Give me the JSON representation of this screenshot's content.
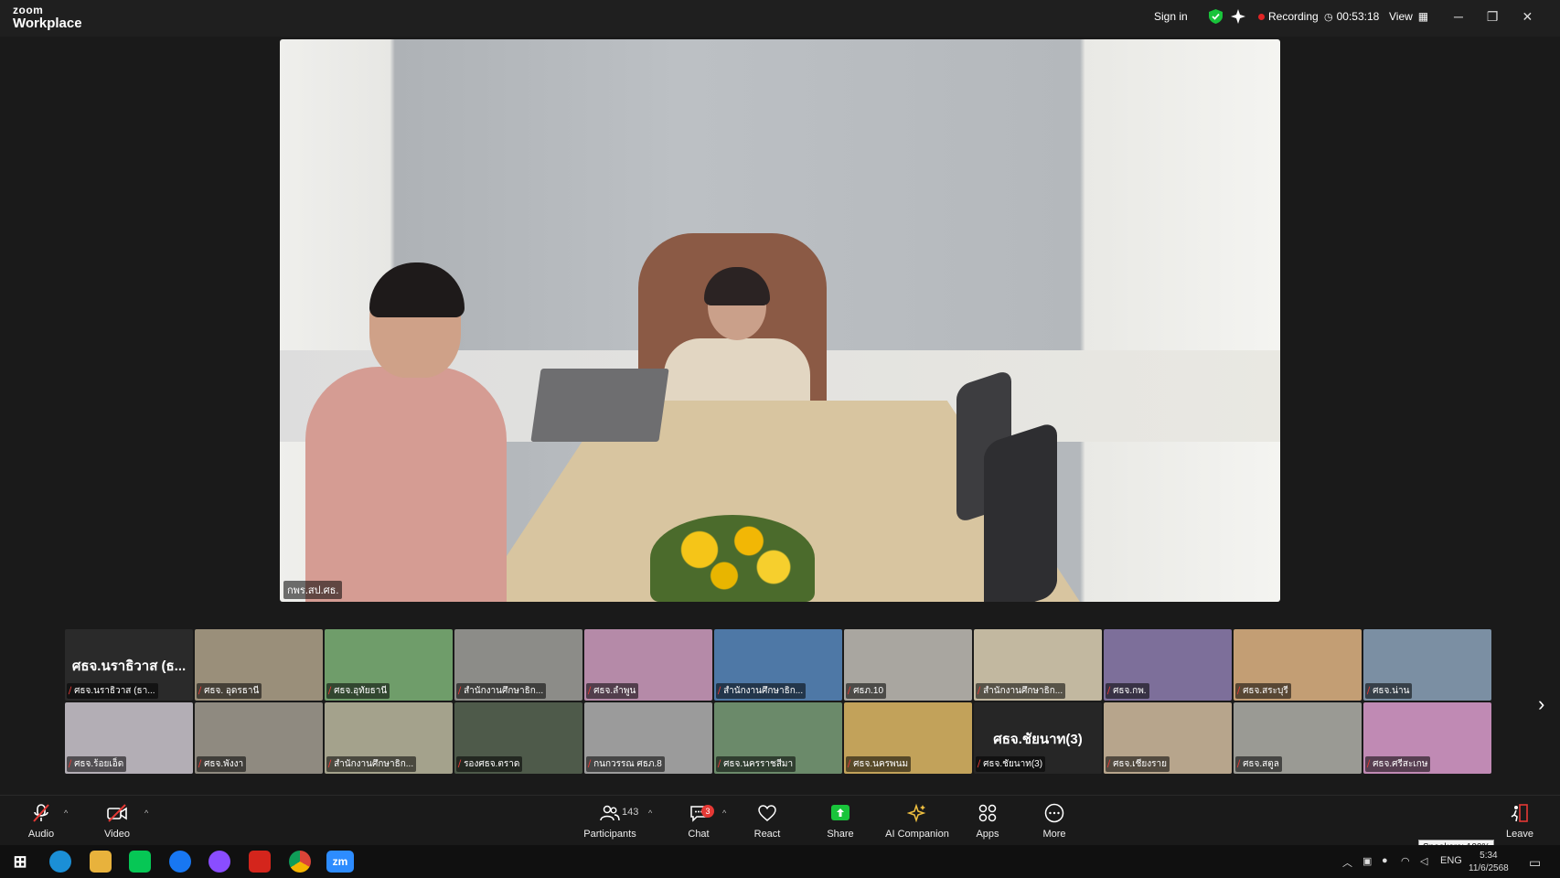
{
  "titlebar": {
    "logo_line1": "zoom",
    "logo_line2": "Workplace",
    "sign_in": "Sign in",
    "recording_label": "Recording",
    "timer": "00:53:18",
    "view_label": "View",
    "minimize": "─",
    "restore": "❐",
    "close": "✕"
  },
  "main_video": {
    "name_label": "กพร.สป.ศธ."
  },
  "gallery": {
    "row1": [
      {
        "name": "ศธจ.นราธิวาส (ธา...",
        "big_name": "ศธจ.นราธิวาส (ธ...",
        "bg": "#2a2a2a"
      },
      {
        "name": "ศธจ. อุดรธานี",
        "bg": "#9a8f7a"
      },
      {
        "name": "ศธจ.อุทัยธานี",
        "bg": "#6f9d6a"
      },
      {
        "name": "สำนักงานศึกษาธิก...",
        "bg": "#8c8c88"
      },
      {
        "name": "ศธจ.ลำพูน",
        "bg": "#b58aa8"
      },
      {
        "name": "สำนักงานศึกษาธิก...",
        "bg": "#4e78a6"
      },
      {
        "name": "ศธภ.10",
        "bg": "#a9a6a0"
      },
      {
        "name": "สำนักงานศึกษาธิก...",
        "bg": "#c2b8a0"
      },
      {
        "name": "ศธจ.กพ.",
        "bg": "#7d6f9a"
      },
      {
        "name": "ศธจ.สระบุรี",
        "bg": "#c39e74"
      },
      {
        "name": "ศธจ.น่าน",
        "bg": "#7b8fa3"
      }
    ],
    "row2": [
      {
        "name": "ศธจ.ร้อยเอ็ด",
        "bg": "#b3aeb5"
      },
      {
        "name": "ศธจ.พังงา",
        "bg": "#8f8a80"
      },
      {
        "name": "สำนักงานศึกษาธิก...",
        "bg": "#a4a28c"
      },
      {
        "name": "รองศธจ.ตราด",
        "bg": "#4e5a4a"
      },
      {
        "name": "กนกวรรณ ศธภ.8",
        "bg": "#9b9b9b"
      },
      {
        "name": "ศธจ.นครราชสีมา",
        "bg": "#6b8a6a"
      },
      {
        "name": "ศธจ.นครพนม",
        "bg": "#c2a25a"
      },
      {
        "name": "ศธจ.ชัยนาท(3)",
        "big_name": "ศธจ.ชัยนาท(3)",
        "bg": "#262626"
      },
      {
        "name": "ศธจ.เชียงราย",
        "bg": "#b7a58c"
      },
      {
        "name": "ศธจ.สตูล",
        "bg": "#9a9a94"
      },
      {
        "name": "ศธจ.ศรีสะเกษ",
        "bg": "#c08ab4"
      }
    ],
    "next_arrow": "›"
  },
  "toolbar": {
    "audio": "Audio",
    "video": "Video",
    "participants": "Participants",
    "participants_count": "143",
    "chat": "Chat",
    "chat_badge": "3",
    "react": "React",
    "share": "Share",
    "ai_companion": "AI Companion",
    "apps": "Apps",
    "more": "More",
    "leave": "Leave",
    "speakers_tooltip": "Speakers: 100%"
  },
  "taskbar": {
    "zoom_app": "zm",
    "language": "ENG",
    "time": "5:34",
    "date": "11/6/2568"
  },
  "colors": {
    "accent_green": "#19c43b",
    "record_red": "#e02424"
  }
}
